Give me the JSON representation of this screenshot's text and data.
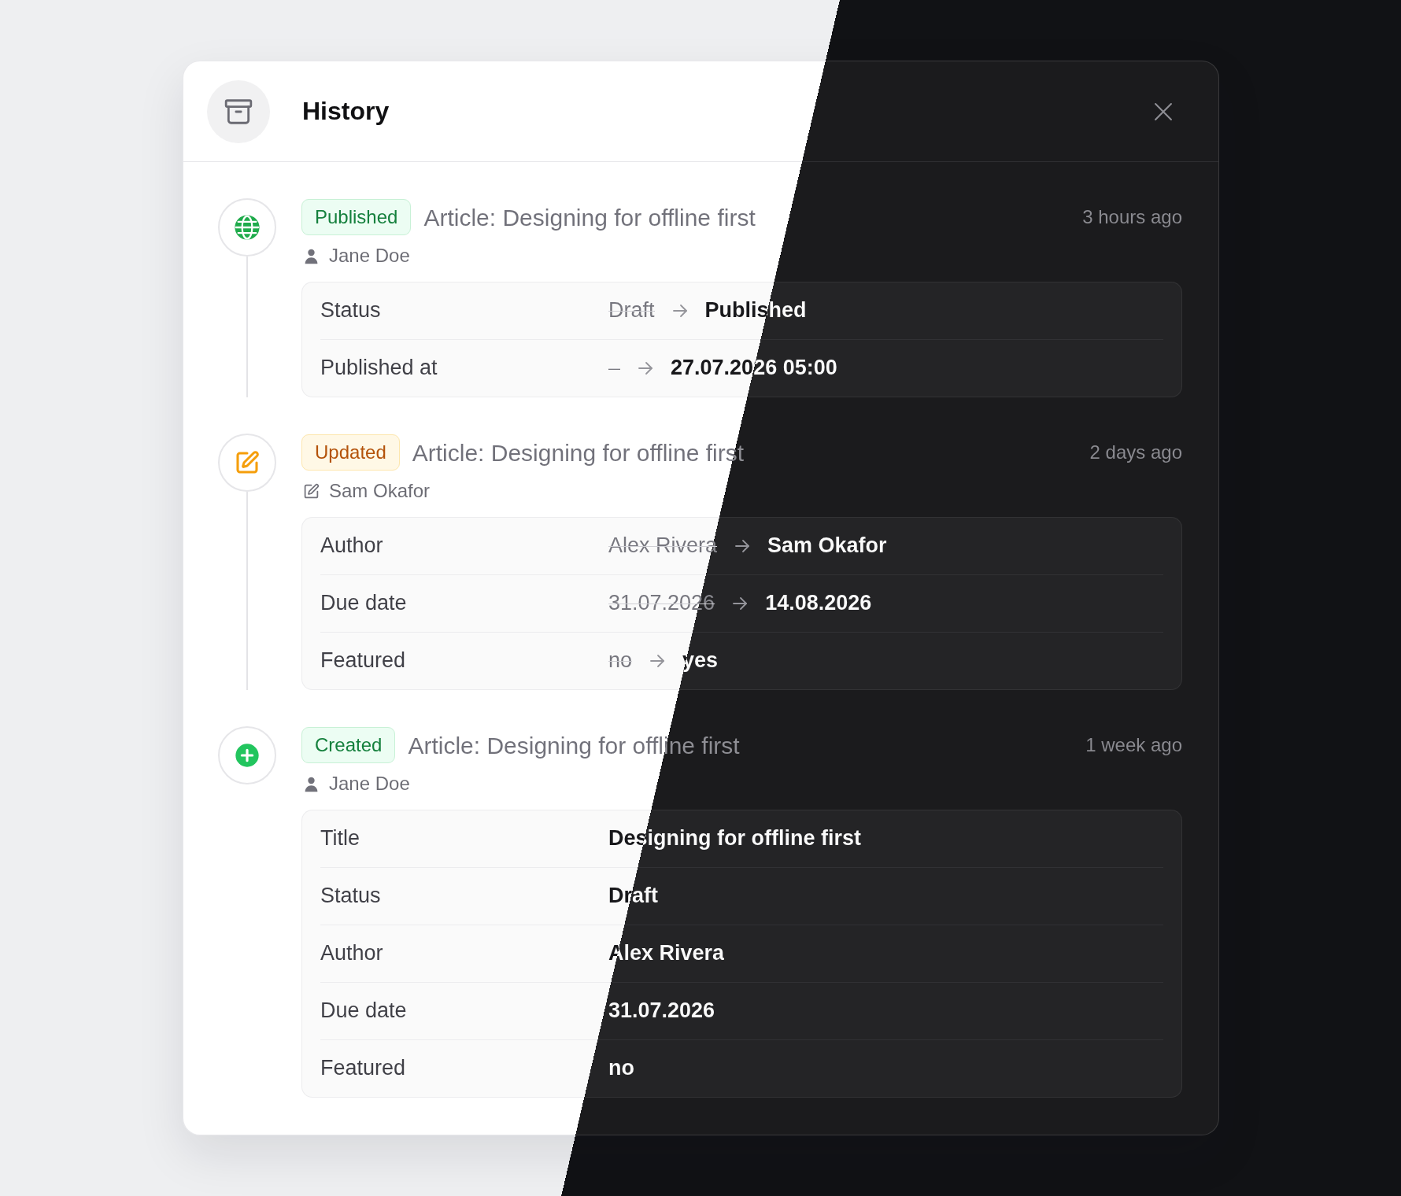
{
  "dialog": {
    "title": "History"
  },
  "entries": [
    {
      "kind": "published",
      "badge": "Published",
      "subject": "Article: Designing for offline first",
      "time": "3 hours ago",
      "actor": "Jane Doe",
      "fields": [
        {
          "kind": "change",
          "label": "Status",
          "from": "Draft",
          "to": "Published"
        },
        {
          "kind": "change",
          "label": "Published at",
          "from": "–",
          "to": "27.07.2026 05:00"
        }
      ]
    },
    {
      "kind": "updated",
      "badge": "Updated",
      "subject": "Article: Designing for offline first",
      "time": "2 days ago",
      "actor": "Sam Okafor",
      "fields": [
        {
          "kind": "change",
          "label": "Author",
          "from": "Alex Rivera",
          "to": "Sam Okafor"
        },
        {
          "kind": "change",
          "label": "Due date",
          "from": "31.07.2026",
          "to": "14.08.2026"
        },
        {
          "kind": "change",
          "label": "Featured",
          "from": "no",
          "to": "yes"
        }
      ]
    },
    {
      "kind": "created",
      "badge": "Created",
      "subject": "Article: Designing for offline first",
      "time": "1 week ago",
      "actor": "Jane Doe",
      "fields": [
        {
          "kind": "value",
          "label": "Title",
          "value": "Designing for offline first"
        },
        {
          "kind": "value",
          "label": "Status",
          "value": "Draft"
        },
        {
          "kind": "value",
          "label": "Author",
          "value": "Alex Rivera"
        },
        {
          "kind": "value",
          "label": "Due date",
          "value": "31.07.2026"
        },
        {
          "kind": "value",
          "label": "Featured",
          "value": "no"
        }
      ]
    }
  ]
}
